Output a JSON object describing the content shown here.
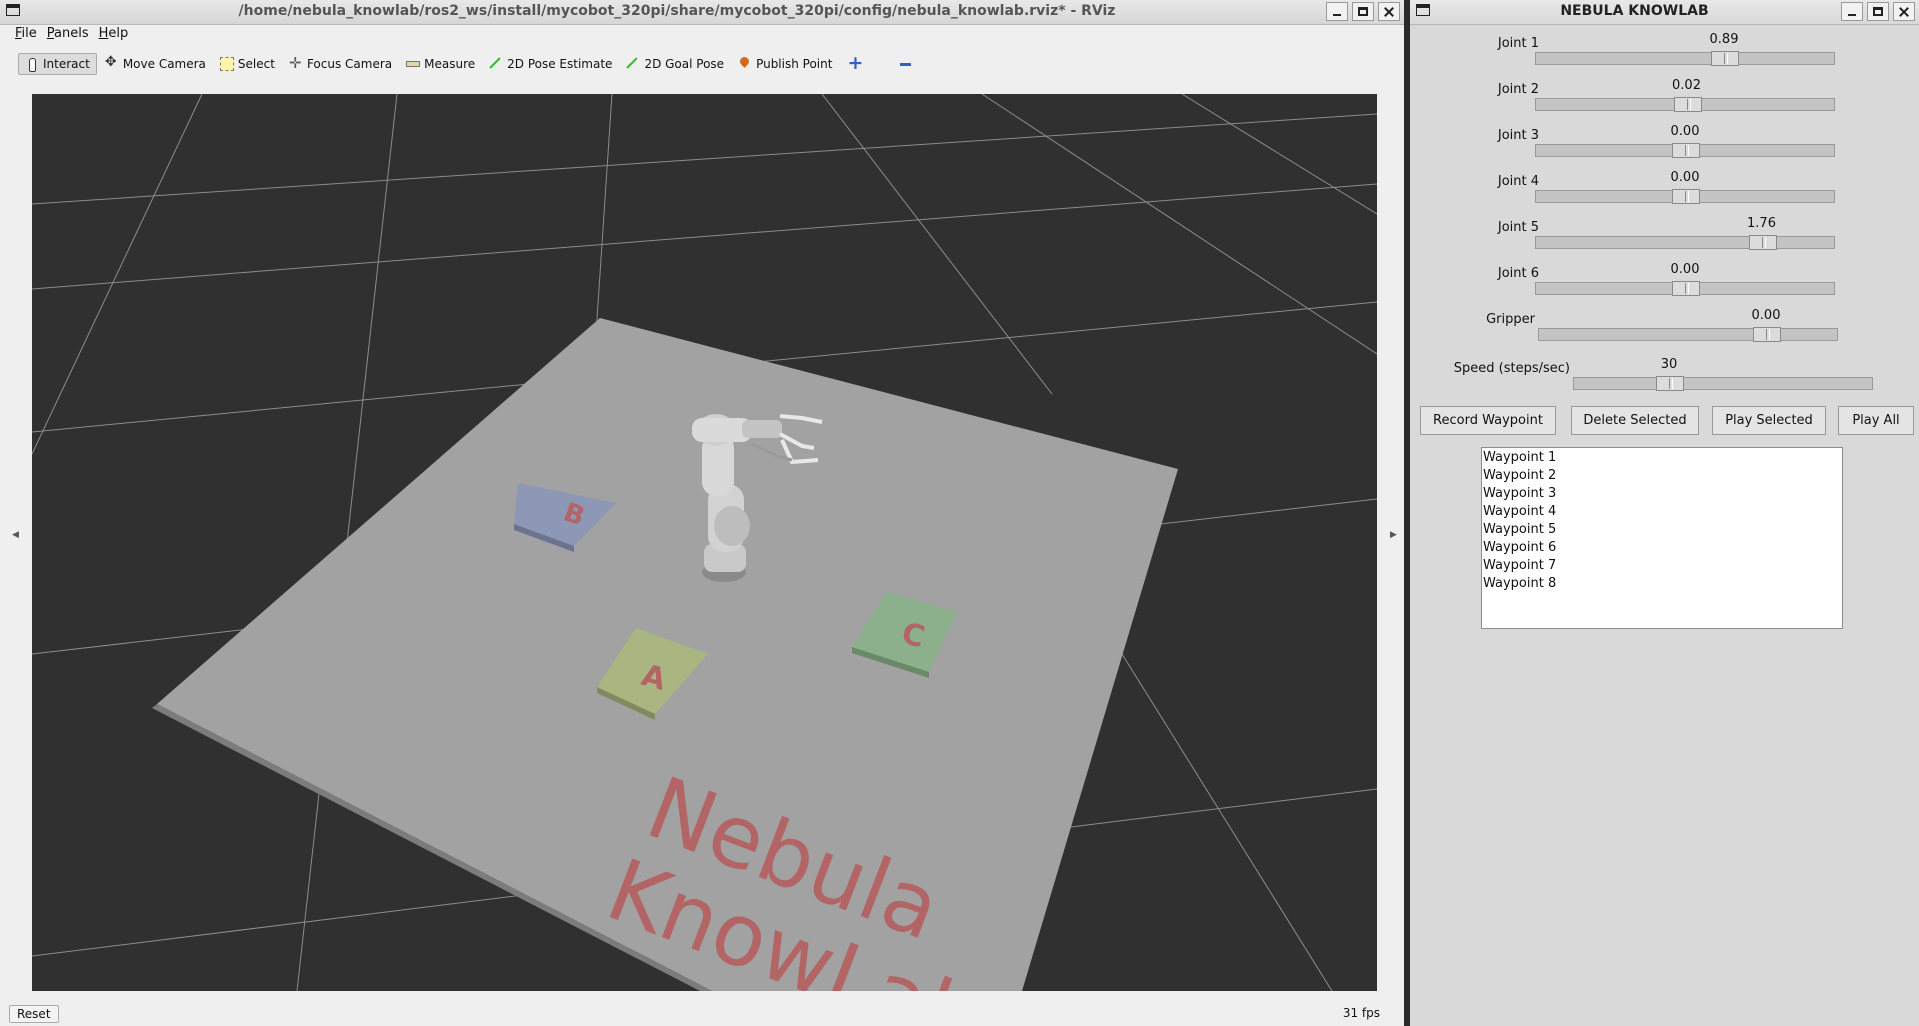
{
  "rviz": {
    "title": "/home/nebula_knowlab/ros2_ws/install/mycobot_320pi/share/mycobot_320pi/config/nebula_knowlab.rviz* - RViz",
    "menu": [
      "File",
      "Panels",
      "Help"
    ],
    "tools": {
      "interact": "Interact",
      "move_camera": "Move Camera",
      "select": "Select",
      "focus_camera": "Focus Camera",
      "measure": "Measure",
      "pose_estimate": "2D Pose Estimate",
      "goal_pose": "2D Goal Pose",
      "publish_point": "Publish Point"
    },
    "scene": {
      "block_a": "A",
      "block_b": "B",
      "block_c": "C",
      "floor_text_line1": "Nebula",
      "floor_text_line2": "KnowLab",
      "block_colors": {
        "a": "#a9b681",
        "b": "#8f98b8",
        "c": "#8bb08b"
      },
      "letter_color": "#b36464"
    },
    "status": {
      "reset": "Reset",
      "fps": "31 fps"
    }
  },
  "panel": {
    "title": "NEBULA KNOWLAB",
    "joints": [
      {
        "label": "Joint 1",
        "value": "0.89",
        "position": 0.63
      },
      {
        "label": "Joint 2",
        "value": "0.02",
        "position": 0.505
      },
      {
        "label": "Joint 3",
        "value": "0.00",
        "position": 0.5
      },
      {
        "label": "Joint 4",
        "value": "0.00",
        "position": 0.5
      },
      {
        "label": "Joint 5",
        "value": "1.76",
        "position": 0.755
      },
      {
        "label": "Joint 6",
        "value": "0.00",
        "position": 0.5
      }
    ],
    "gripper": {
      "label": "Gripper",
      "value": "0.00",
      "position": 0.76
    },
    "speed": {
      "label": "Speed (steps/sec)",
      "value": "30",
      "position": 0.32
    },
    "buttons": {
      "record": "Record Waypoint",
      "delete": "Delete Selected",
      "play_selected": "Play Selected",
      "play_all": "Play All"
    },
    "waypoints": [
      "Waypoint 1",
      "Waypoint 2",
      "Waypoint 3",
      "Waypoint 4",
      "Waypoint 5",
      "Waypoint 6",
      "Waypoint 7",
      "Waypoint 8"
    ]
  }
}
